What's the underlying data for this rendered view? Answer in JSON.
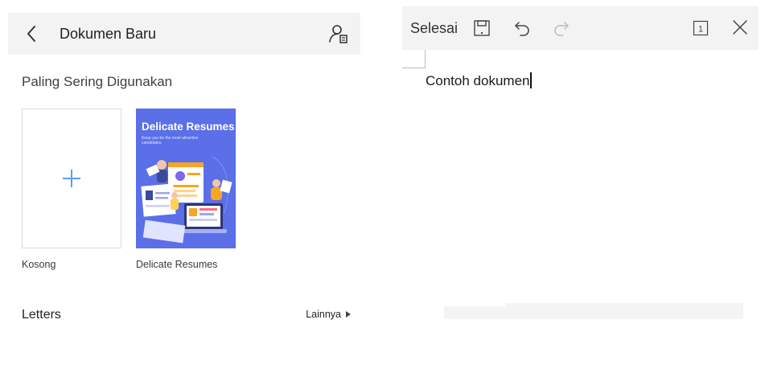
{
  "new_doc_panel": {
    "header": {
      "title": "Dokumen Baru"
    },
    "section_title": "Paling Sering Digunakan",
    "templates": [
      {
        "label": "Kosong"
      },
      {
        "label": "Delicate Resumes",
        "thumb_title": "Delicate Resumes",
        "thumb_subtitle": "Keep you be the most attractive candidates."
      }
    ],
    "category": {
      "title": "Letters",
      "more_label": "Lainnya"
    }
  },
  "editor": {
    "toolbar": {
      "done_label": "Selesai",
      "page_number": "1"
    },
    "document_text": "Contoh dokumen"
  },
  "colors": {
    "accent": "#5b9ef0",
    "header_bg": "#f3f3f3",
    "resume_thumb_bg": "#5a6fe8"
  },
  "icons": [
    "back-icon",
    "account-icon",
    "plus-icon",
    "save-icon",
    "undo-icon",
    "redo-icon",
    "page-count-icon",
    "close-icon",
    "more-arrow-icon"
  ]
}
